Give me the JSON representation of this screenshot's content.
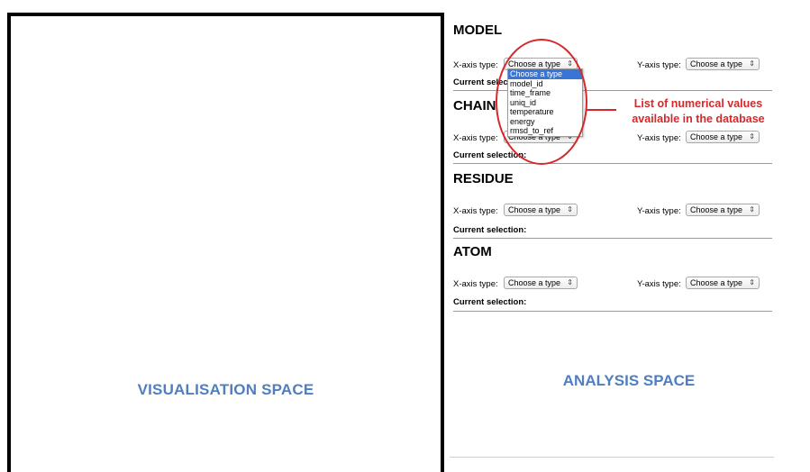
{
  "visualisation": {
    "label": "VISUALISATION SPACE"
  },
  "analysis": {
    "label": "ANALYSIS SPACE"
  },
  "axis_labels": {
    "x": "X-axis type:",
    "y": "Y-axis type:"
  },
  "current_selection_label": "Current selection:",
  "sections": [
    {
      "title": "MODEL",
      "x_select": "Choose a type",
      "y_select": "Choose a type"
    },
    {
      "title": "CHAIN",
      "x_select": "Choose a type",
      "y_select": "Choose a type"
    },
    {
      "title": "RESIDUE",
      "x_select": "Choose a type",
      "y_select": "Choose a type"
    },
    {
      "title": "ATOM",
      "x_select": "Choose a type",
      "y_select": "Choose a type"
    }
  ],
  "dropdown": {
    "options": [
      "Choose a type",
      "model_id",
      "time_frame",
      "uniq_id",
      "temperature",
      "energy",
      "rmsd_to_ref"
    ],
    "selected": "Choose a type"
  },
  "annotation": {
    "line1": "List of numerical values",
    "line2": "available in the database",
    "color": "#d6282b"
  },
  "colors": {
    "panel_label": "#4f7fc0",
    "highlight": "#3875d7"
  }
}
